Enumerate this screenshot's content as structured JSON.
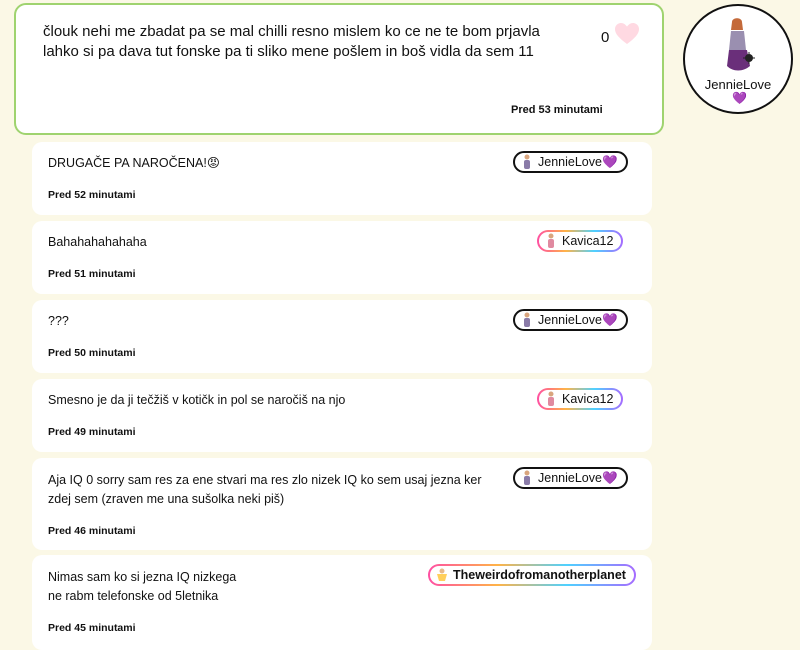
{
  "post": {
    "text": "člouk nehi me zbadat pa se mal chilli resno mislem ko ce ne te bom prjavla lahko si pa dava tut fonske pa ti sliko mene pošlem in boš vidla da sem 11",
    "likes": "0",
    "time": "Pred 53 minutami",
    "author": "JennieLove",
    "author_emoji": "💜"
  },
  "comments": [
    {
      "text": "DRUGAČE PA NAROČENA!😡",
      "time": "Pred 52 minutami",
      "user": "JennieLove💜",
      "style": "dark"
    },
    {
      "text": "Bahahahahahaha",
      "time": "Pred 51 minutami",
      "user": "Kavica12",
      "style": "rainbow"
    },
    {
      "text": "???",
      "time": "Pred 50 minutami",
      "user": "JennieLove💜",
      "style": "dark"
    },
    {
      "text": "Smesno je da ji tečžiš v kotičk in pol se naročiš na njo",
      "time": "Pred 49 minutami",
      "user": "Kavica12",
      "style": "rainbow"
    },
    {
      "text_line1": "Aja IQ 0 sorry sam res za ene stvari ma res zlo nizek IQ ko sem usaj jezna ker",
      "text_line2": "zdej sem (zraven me una sušolka neki piš)",
      "time": "Pred 46 minutami",
      "user": "JennieLove💜",
      "style": "dark"
    },
    {
      "text_line1": "Nimas sam ko si jezna IQ nizkega",
      "text_line2": "ne rabm telefonske od 5letnika",
      "time": "Pred 45 minutami",
      "user": "Theweirdofromanotherplanet",
      "style": "rainbow"
    }
  ],
  "colors": {
    "background": "#fbf8e6",
    "post_border": "#9fd36f",
    "heart": "#ffd9e2"
  },
  "icons": {
    "like": "heart-icon",
    "avatar": "girl-figure-icon"
  }
}
